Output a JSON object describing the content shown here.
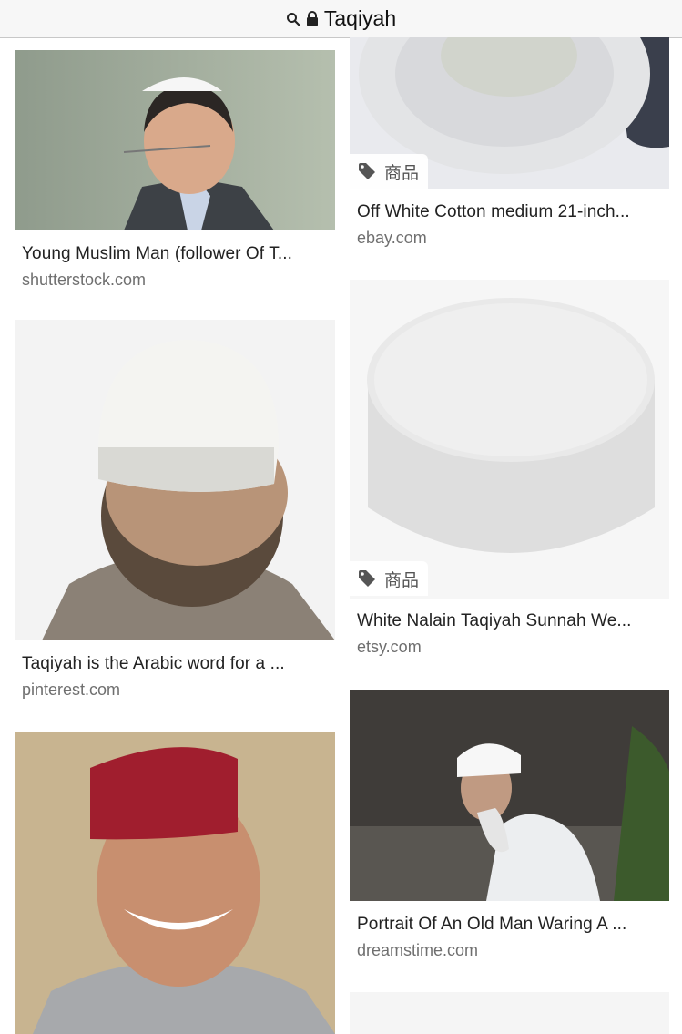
{
  "address_bar": {
    "query": "Taqiyah",
    "search_icon": "search-icon",
    "lock_icon": "lock-icon"
  },
  "results": [
    {
      "title": "Young Muslim Man (follower Of T...",
      "source": "shutterstock.com",
      "tag": null
    },
    {
      "title": "Off White Cotton medium 21-inch...",
      "source": "ebay.com",
      "tag": "商品"
    },
    {
      "title": "Taqiyah is the Arabic word for a ...",
      "source": "pinterest.com",
      "tag": null
    },
    {
      "title": "White Nalain Taqiyah Sunnah We...",
      "source": "etsy.com",
      "tag": "商品"
    },
    {
      "title": "Portrait Of An Old Man Waring A ...",
      "source": "dreamstime.com",
      "tag": null
    },
    {
      "title": "",
      "source": "",
      "tag": null
    },
    {
      "title": "",
      "source": "",
      "tag": null
    }
  ],
  "tag_icon": "price-tag-icon",
  "colors": {
    "title_text": "#222222",
    "source_text": "#6f6f6f",
    "topbar_bg": "#f7f7f7"
  }
}
